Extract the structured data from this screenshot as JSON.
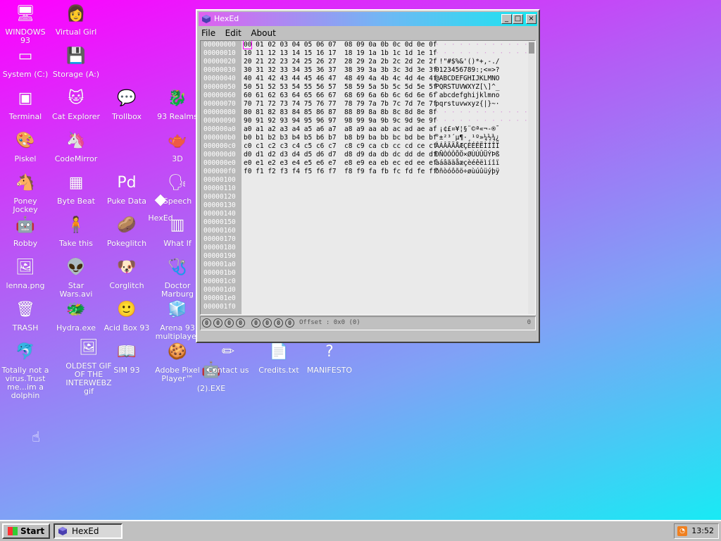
{
  "desktop": {
    "icons": [
      {
        "label": "WINDOWS 93",
        "glyph": "🖥"
      },
      {
        "label": "Virtual Girl",
        "glyph": "👩"
      },
      {
        "label": "System (C:)",
        "glyph": "▭"
      },
      {
        "label": "Storage (A:)",
        "glyph": "💾"
      },
      {
        "label": "Terminal",
        "glyph": "▣"
      },
      {
        "label": "Cat Explorer",
        "glyph": "🐱"
      },
      {
        "label": "Trollbox",
        "glyph": "💬"
      },
      {
        "label": "93 Realms",
        "glyph": "🐉"
      },
      {
        "label": "Piskel",
        "glyph": "🎨"
      },
      {
        "label": "CodeMirror",
        "glyph": "🦄"
      },
      {
        "label": "3D",
        "glyph": "🫖"
      },
      {
        "label": "Poney Jockey",
        "glyph": "🐴"
      },
      {
        "label": "Byte Beat",
        "glyph": "▦"
      },
      {
        "label": "Puke Data",
        "glyph": "Pd"
      },
      {
        "label": "Speech",
        "glyph": "🗣"
      },
      {
        "label": "HexEd",
        "glyph": "◆"
      },
      {
        "label": "Robby",
        "glyph": "🤖"
      },
      {
        "label": "Take this",
        "glyph": "🧍"
      },
      {
        "label": "Pokeglitch",
        "glyph": "🥔"
      },
      {
        "label": "What If",
        "glyph": "▥"
      },
      {
        "label": "lenna.png",
        "glyph": "🖼"
      },
      {
        "label": "Star Wars.avi",
        "glyph": "👽"
      },
      {
        "label": "Corglitch",
        "glyph": "🐶"
      },
      {
        "label": "Doctor Marburg",
        "glyph": "🩺"
      },
      {
        "label": "TRASH",
        "glyph": "🗑"
      },
      {
        "label": "Hydra.exe",
        "glyph": "🐲"
      },
      {
        "label": "Acid Box 93",
        "glyph": "🙂"
      },
      {
        "label": "Arena 93 multiplayer",
        "glyph": "🧊"
      },
      {
        "label": "Totally not a virus.Trust me...im a dolphin",
        "glyph": "🐬"
      },
      {
        "label": "OLDEST GIF OF THE INTERWEBZ gif",
        "glyph": "🖼"
      },
      {
        "label": "SIM 93",
        "glyph": "📖"
      },
      {
        "label": "Adobe Pixel Player™",
        "glyph": "🍪"
      },
      {
        "label": "(2).EXE",
        "glyph": "🤖"
      },
      {
        "label": "Contact us",
        "glyph": "✏"
      },
      {
        "label": "Credits.txt",
        "glyph": "📄"
      },
      {
        "label": "MANIFESTO",
        "glyph": "?"
      }
    ]
  },
  "window": {
    "title": "HexEd",
    "buttons": {
      "minimize": "_",
      "maximize": "□",
      "close": "×"
    },
    "menu": [
      "File",
      "Edit",
      "About"
    ],
    "offsets": [
      "00000000",
      "00000010",
      "00000020",
      "00000030",
      "00000040",
      "00000050",
      "00000060",
      "00000070",
      "00000080",
      "00000090",
      "000000a0",
      "000000b0",
      "000000c0",
      "000000d0",
      "000000e0",
      "000000f0",
      "00000100",
      "00000110",
      "00000120",
      "00000130",
      "00000140",
      "00000150",
      "00000160",
      "00000170",
      "00000180",
      "00000190",
      "000001a0",
      "000001b0",
      "000001c0",
      "000001d0",
      "000001e0",
      "000001f0"
    ],
    "hex_rows": [
      "00 01 02 03 04 05 06 07  08 09 0a 0b 0c 0d 0e 0f",
      "10 11 12 13 14 15 16 17  18 19 1a 1b 1c 1d 1e 1f",
      "20 21 22 23 24 25 26 27  28 29 2a 2b 2c 2d 2e 2f",
      "30 31 32 33 34 35 36 37  38 39 3a 3b 3c 3d 3e 3f",
      "40 41 42 43 44 45 46 47  48 49 4a 4b 4c 4d 4e 4f",
      "50 51 52 53 54 55 56 57  58 59 5a 5b 5c 5d 5e 5f",
      "60 61 62 63 64 65 66 67  68 69 6a 6b 6c 6d 6e 6f",
      "70 71 72 73 74 75 76 77  78 79 7a 7b 7c 7d 7e 7f",
      "80 81 82 83 84 85 86 87  88 89 8a 8b 8c 8d 8e 8f",
      "90 91 92 93 94 95 96 97  98 99 9a 9b 9c 9d 9e 9f",
      "a0 a1 a2 a3 a4 a5 a6 a7  a8 a9 aa ab ac ad ae af",
      "b0 b1 b2 b3 b4 b5 b6 b7  b8 b9 ba bb bc bd be bf",
      "c0 c1 c2 c3 c4 c5 c6 c7  c8 c9 ca cb cc cd ce cf",
      "d0 d1 d2 d3 d4 d5 d6 d7  d8 d9 da db dc dd de df",
      "e0 e1 e2 e3 e4 e5 e6 e7  e8 e9 ea eb ec ed ee ef",
      "f0 f1 f2 f3 f4 f5 f6 f7  f8 f9 fa fb fc fd fe ff"
    ],
    "ascii_rows": [
      "· · · · · · · · · · · · · · · ·",
      "· · · · · · · · · · · · · · · ·",
      " !\"#$%&'()*+,-./",
      "0123456789:;<=>?",
      "@ABCDEFGHIJKLMNO",
      "PQRSTUVWXYZ[\\]^_",
      "`abcdefghijklmno",
      "pqrstuvwxyz{|}~·",
      "· · · · · · · · · · · · · · · ·",
      "· · · · · · · · · · · · · · · ·",
      " ¡¢£¤¥¦§¨©ª«¬-®¯",
      "°±²³´µ¶·¸¹º»¼½¾¿",
      "ÀÁÂÃÄÅÆÇÈÉÊËÌÍÎÏ",
      "ÐÑÒÓÔÕÖ×ØÙÚÛÜÝÞß",
      "àáâãäåæçèéêëìíîï",
      "ðñòóôõö÷øùúûüýþÿ"
    ],
    "status": {
      "bits": [
        "0",
        "0",
        "0",
        "0",
        "0",
        "0",
        "0",
        "0"
      ],
      "offset_text": "Offset : 0x0 (0)",
      "right_value": "0"
    }
  },
  "taskbar": {
    "start_label": "Start",
    "tasks": [
      {
        "label": "HexEd"
      }
    ],
    "clock": "13:52"
  }
}
